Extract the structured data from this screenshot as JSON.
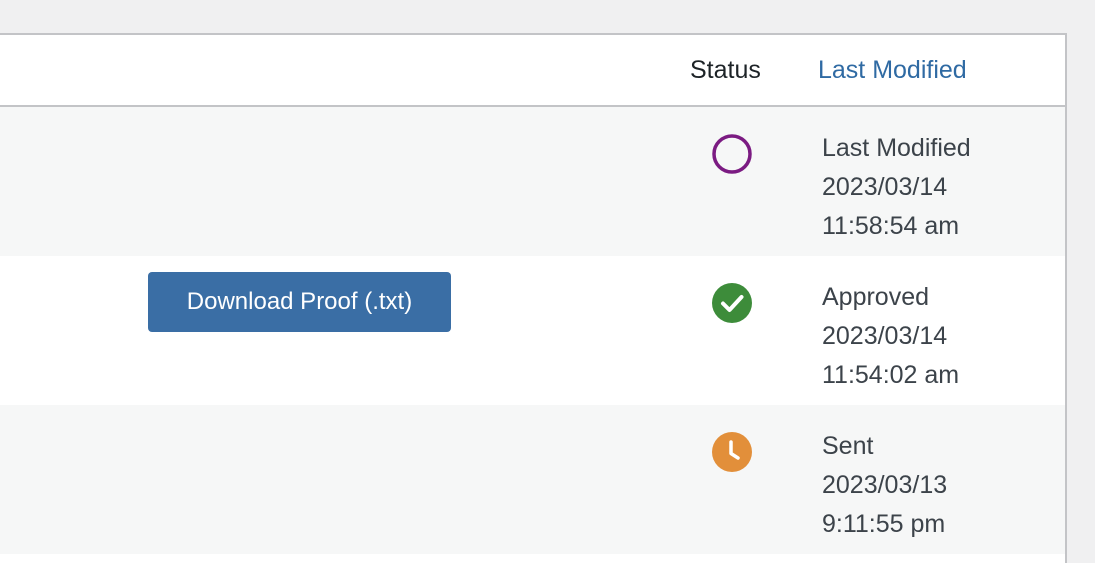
{
  "table": {
    "columns": {
      "status": "Status",
      "last_modified": "Last Modified"
    },
    "rows": [
      {
        "status_icon": "empty-circle-icon",
        "status_color": "#7b1b82",
        "modified_label": "Last Modified",
        "date": "2023/03/14",
        "time": "11:58:54 am",
        "action_label": ""
      },
      {
        "status_icon": "checkmark-circle-icon",
        "status_color": "#3d8c3a",
        "modified_label": "Approved",
        "date": "2023/03/14",
        "time": "11:54:02 am",
        "action_label": "Download Proof (.txt)"
      },
      {
        "status_icon": "clock-circle-icon",
        "status_color": "#e28f3a",
        "modified_label": "Sent",
        "date": "2023/03/13",
        "time": "9:11:55 pm",
        "action_label": ""
      }
    ]
  }
}
